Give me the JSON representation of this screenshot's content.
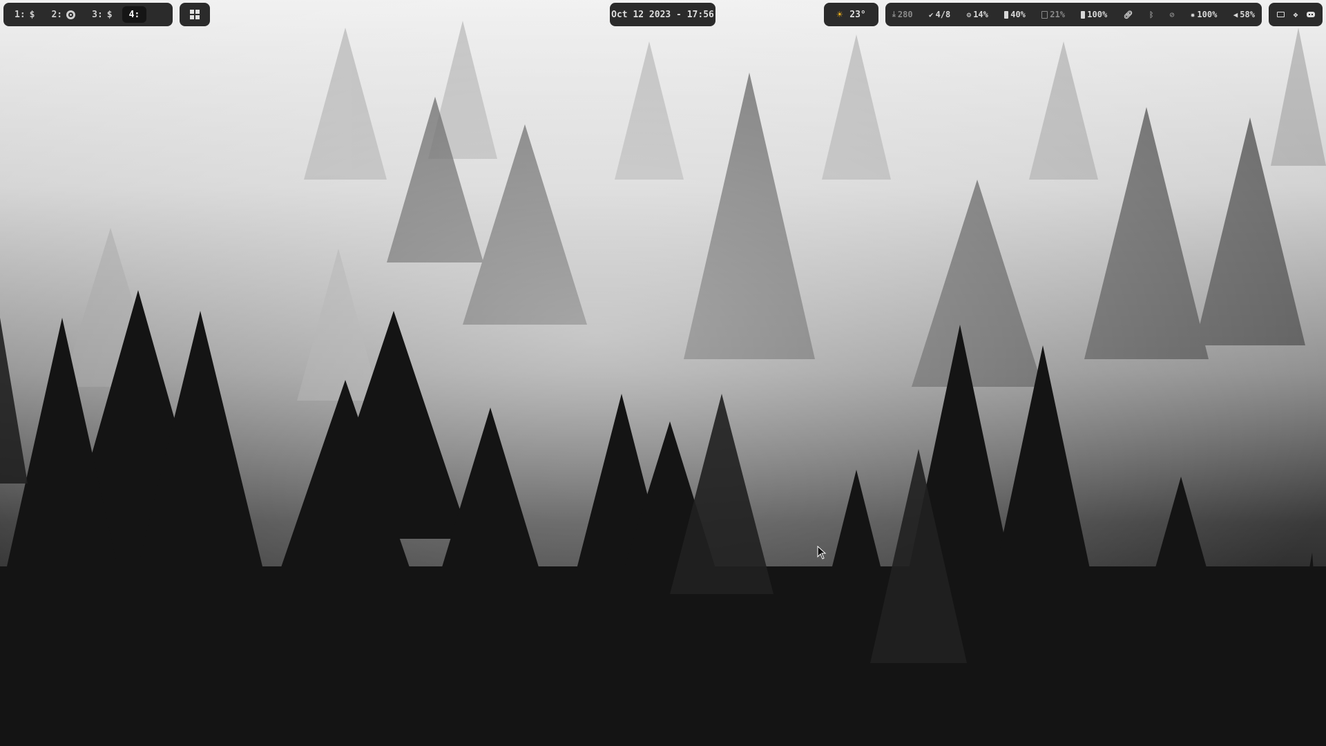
{
  "workspaces": [
    {
      "index": "1:",
      "glyph": "$",
      "active": false
    },
    {
      "index": "2:",
      "glyph": "chrome-icon",
      "active": false
    },
    {
      "index": "3:",
      "glyph": "$",
      "active": false
    },
    {
      "index": "4:",
      "glyph": "",
      "active": true
    }
  ],
  "launcher": {
    "icon": "windows-icon"
  },
  "clock": {
    "text": "Oct 12 2023 - 17:56"
  },
  "weather": {
    "icon": "sun-icon",
    "text": "23°",
    "icon_color": "#f2b21c"
  },
  "status": {
    "updates": {
      "icon": "download-icon",
      "text": "280"
    },
    "tasks": {
      "icon": "check-icon",
      "text": "4/8"
    },
    "cpu": {
      "icon": "cpu-icon",
      "text": "14%"
    },
    "memory": {
      "icon": "memory-icon",
      "text": "40%"
    },
    "disk": {
      "icon": "disk-icon",
      "text": "21%"
    },
    "battery": {
      "icon": "battery-icon",
      "text": "100%"
    },
    "network": {
      "icon": "link-icon"
    },
    "bluetooth": {
      "icon": "bluetooth-icon"
    },
    "visibility": {
      "icon": "eye-slash-icon"
    },
    "brightness": {
      "icon": "brightness-icon",
      "text": "100%"
    },
    "volume": {
      "icon": "volume-icon",
      "text": "58%"
    }
  },
  "tray": [
    {
      "icon": "monitor-icon"
    },
    {
      "icon": "dropbox-icon"
    },
    {
      "icon": "gamepad-icon"
    }
  ],
  "colors": {
    "bar_bg": "#2b2b2b",
    "active_ws_bg": "#151515",
    "text": "#d6d6d6"
  }
}
